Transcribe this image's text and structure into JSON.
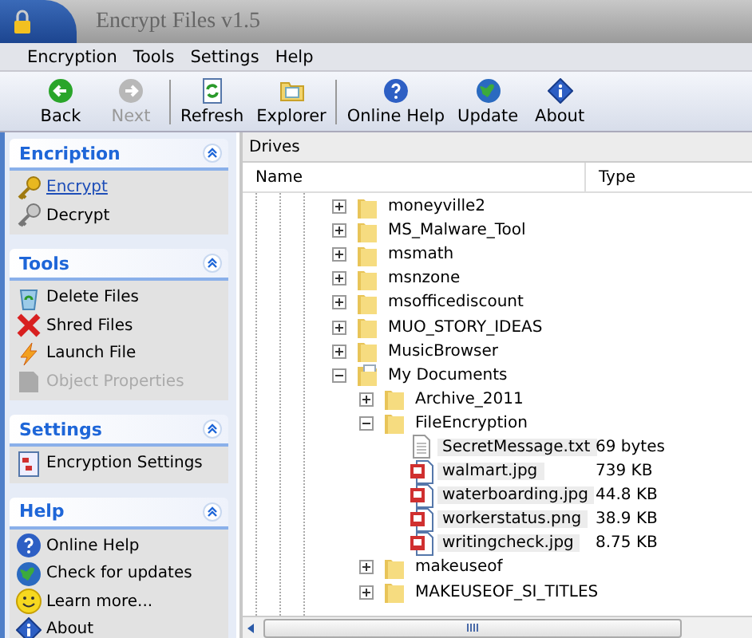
{
  "window": {
    "title": "Encrypt Files v1.5"
  },
  "menu": [
    {
      "label": "Encryption"
    },
    {
      "label": "Tools"
    },
    {
      "label": "Settings"
    },
    {
      "label": "Help"
    }
  ],
  "toolbar": [
    {
      "kind": "back",
      "label": "Back",
      "disabled": false
    },
    {
      "kind": "next",
      "label": "Next",
      "disabled": true
    },
    {
      "kind": "separator"
    },
    {
      "kind": "refresh",
      "label": "Refresh",
      "disabled": false
    },
    {
      "kind": "explorer",
      "label": "Explorer",
      "disabled": false
    },
    {
      "kind": "separator"
    },
    {
      "kind": "help",
      "label": "Online Help",
      "disabled": false
    },
    {
      "kind": "globe",
      "label": "Update",
      "disabled": false
    },
    {
      "kind": "about",
      "label": "About",
      "disabled": false
    }
  ],
  "sidebar": {
    "groups": [
      {
        "title": "Encription",
        "expanded": true,
        "items": [
          {
            "label": "Encrypt",
            "kind": "key",
            "selected": true,
            "disabled": false
          },
          {
            "label": "Decrypt",
            "kind": "key-grey",
            "selected": false,
            "disabled": false
          }
        ]
      },
      {
        "title": "Tools",
        "expanded": true,
        "items": [
          {
            "label": "Delete Files",
            "kind": "recycle",
            "selected": false,
            "disabled": false
          },
          {
            "label": "Shred Files",
            "kind": "cross",
            "selected": false,
            "disabled": false
          },
          {
            "label": "Launch File",
            "kind": "bolt",
            "selected": false,
            "disabled": false
          },
          {
            "label": "Object Properties",
            "kind": "doc-grey",
            "selected": false,
            "disabled": true
          }
        ]
      },
      {
        "title": "Settings",
        "expanded": true,
        "items": [
          {
            "label": "Encryption Settings",
            "kind": "settings",
            "selected": false,
            "disabled": false
          }
        ]
      },
      {
        "title": "Help",
        "expanded": true,
        "items": [
          {
            "label": "Online Help",
            "kind": "help",
            "selected": false,
            "disabled": false
          },
          {
            "label": "Check for updates",
            "kind": "globe",
            "selected": false,
            "disabled": false
          },
          {
            "label": "Learn more...",
            "kind": "smiley",
            "selected": false,
            "disabled": false
          },
          {
            "label": "About",
            "kind": "about",
            "selected": false,
            "disabled": false
          }
        ]
      }
    ]
  },
  "drives": {
    "title": "Drives",
    "columns": [
      "Name",
      "Type"
    ],
    "tree": [
      {
        "kind": "folder",
        "name": "moneyville2",
        "expanded": false
      },
      {
        "kind": "folder",
        "name": "MS_Malware_Tool",
        "expanded": false
      },
      {
        "kind": "folder",
        "name": "msmath",
        "expanded": false
      },
      {
        "kind": "folder",
        "name": "msnzone",
        "expanded": false
      },
      {
        "kind": "folder",
        "name": "msofficediscount",
        "expanded": false
      },
      {
        "kind": "folder",
        "name": "MUO_STORY_IDEAS",
        "expanded": false
      },
      {
        "kind": "folder",
        "name": "MusicBrowser",
        "expanded": false
      },
      {
        "kind": "documents",
        "name": "My Documents",
        "expanded": true,
        "children": [
          {
            "kind": "folder",
            "name": "Archive_2011",
            "expanded": false
          },
          {
            "kind": "folder",
            "name": "FileEncryption",
            "expanded": true,
            "children": [
              {
                "kind": "text",
                "name": "SecretMessage.txt",
                "type": "69 bytes"
              },
              {
                "kind": "image",
                "name": "walmart.jpg",
                "type": "739 KB"
              },
              {
                "kind": "image",
                "name": "waterboarding.jpg",
                "type": "44.8 KB"
              },
              {
                "kind": "image",
                "name": "workerstatus.png",
                "type": "38.9 KB"
              },
              {
                "kind": "image",
                "name": "writingcheck.jpg",
                "type": "8.75 KB"
              }
            ]
          },
          {
            "kind": "folder",
            "name": "makeuseof",
            "expanded": false
          },
          {
            "kind": "folder",
            "name": "MAKEUSEOF_SI_TITLES",
            "expanded": false
          }
        ]
      }
    ]
  }
}
